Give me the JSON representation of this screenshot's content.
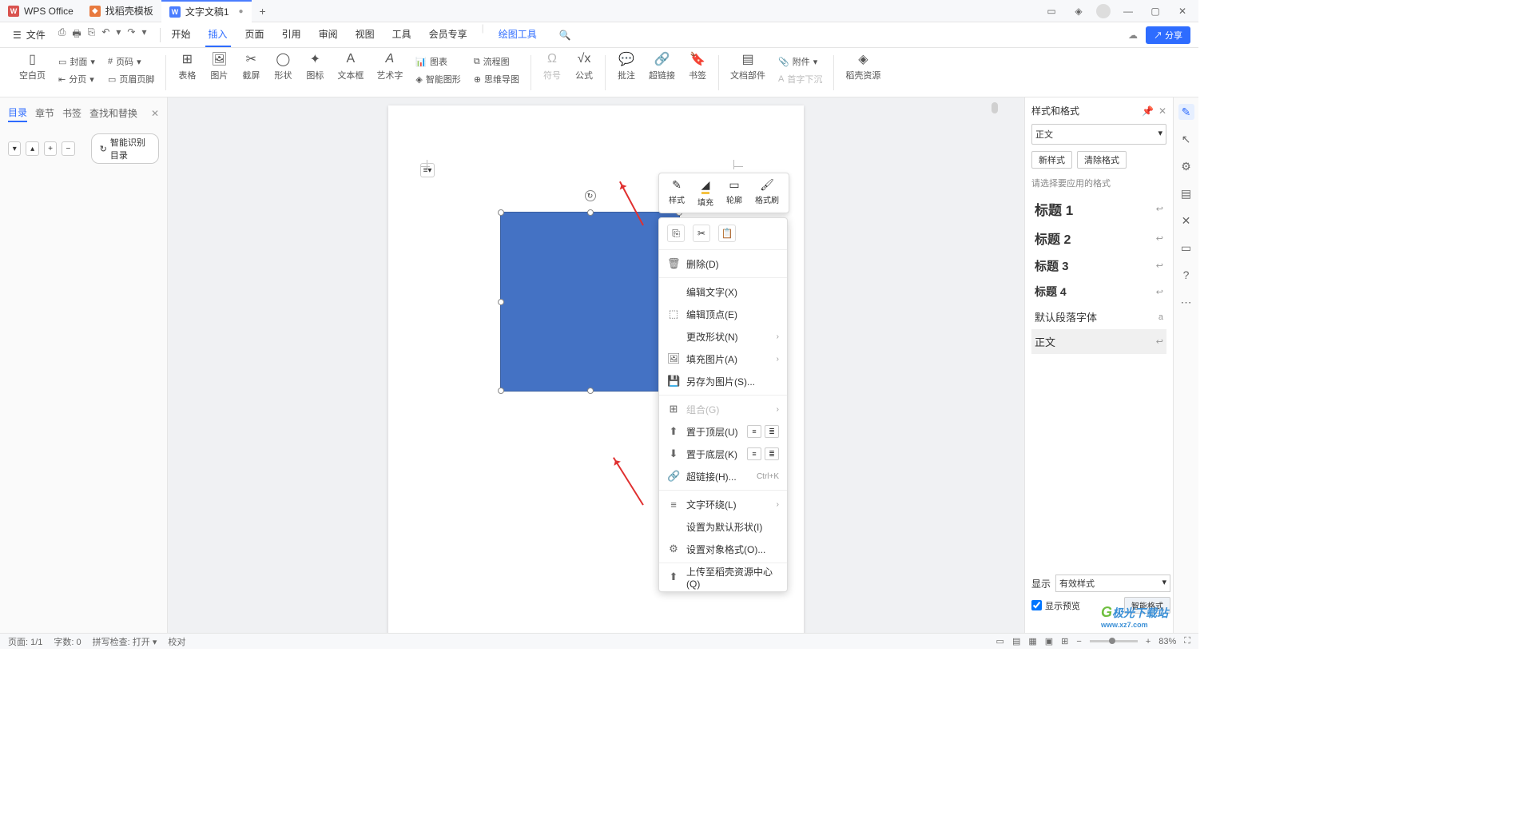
{
  "titlebar": {
    "tabs": [
      {
        "icon_bg": "#d9534f",
        "icon_text": "W",
        "label": "WPS Office"
      },
      {
        "icon_bg": "#e87a3f",
        "icon_text": "◆",
        "label": "找稻壳模板"
      },
      {
        "icon_bg": "#4a7dff",
        "icon_text": "W",
        "label": "文字文稿1",
        "active": true
      }
    ]
  },
  "menubar": {
    "file": "文件",
    "tabs": [
      "开始",
      "插入",
      "页面",
      "引用",
      "审阅",
      "视图",
      "工具",
      "会员专享"
    ],
    "active_tab": "插入",
    "extra_tab": "绘图工具",
    "share": "分享"
  },
  "ribbon": {
    "blank_page": "空白页",
    "cover": "封面",
    "page_num": "页码",
    "page_break": "分页",
    "header_footer": "页眉页脚",
    "table": "表格",
    "picture": "图片",
    "screenshot": "截屏",
    "shape": "形状",
    "icon": "图标",
    "textbox": "文本框",
    "wordart": "艺术字",
    "chart": "图表",
    "flowchart": "流程图",
    "smartart": "智能图形",
    "mindmap": "思维导图",
    "symbol": "符号",
    "equation": "公式",
    "comment": "批注",
    "hyperlink": "超链接",
    "bookmark": "书签",
    "doc_parts": "文档部件",
    "attachment": "附件",
    "dropcap": "首字下沉",
    "resource": "稻壳资源"
  },
  "nav": {
    "tabs": [
      "目录",
      "章节",
      "书签",
      "查找和替换"
    ],
    "active": "目录",
    "smart_toc": "智能识别目录"
  },
  "float_toolbar": {
    "style": "样式",
    "fill": "填充",
    "outline": "轮廓",
    "format_painter": "格式刷"
  },
  "context_menu": {
    "delete": "删除(D)",
    "edit_text": "编辑文字(X)",
    "edit_points": "编辑顶点(E)",
    "change_shape": "更改形状(N)",
    "fill_picture": "填充图片(A)",
    "save_as_picture": "另存为图片(S)...",
    "group": "组合(G)",
    "bring_front": "置于顶层(U)",
    "send_back": "置于底层(K)",
    "hyperlink": "超链接(H)...",
    "hyperlink_shortcut": "Ctrl+K",
    "text_wrap": "文字环绕(L)",
    "set_default": "设置为默认形状(I)",
    "format_object": "设置对象格式(O)...",
    "upload_resource": "上传至稻壳资源中心(Q)"
  },
  "right_panel": {
    "title": "样式和格式",
    "current": "正文",
    "new_style": "新样式",
    "clear_format": "清除格式",
    "select_label": "请选择要应用的格式",
    "styles": [
      "标题 1",
      "标题 2",
      "标题 3",
      "标题 4"
    ],
    "default_para": "默认段落字体",
    "body": "正文",
    "show_label": "显示",
    "show_value": "有效样式",
    "preview": "显示预览",
    "smart_format": "智能格式"
  },
  "statusbar": {
    "page": "页面: 1/1",
    "words": "字数: 0",
    "spell": "拼写检查: 打开",
    "proofread": "校对",
    "zoom": "83%"
  },
  "watermark": {
    "text": "极光下载站",
    "url": "www.xz7.com"
  }
}
